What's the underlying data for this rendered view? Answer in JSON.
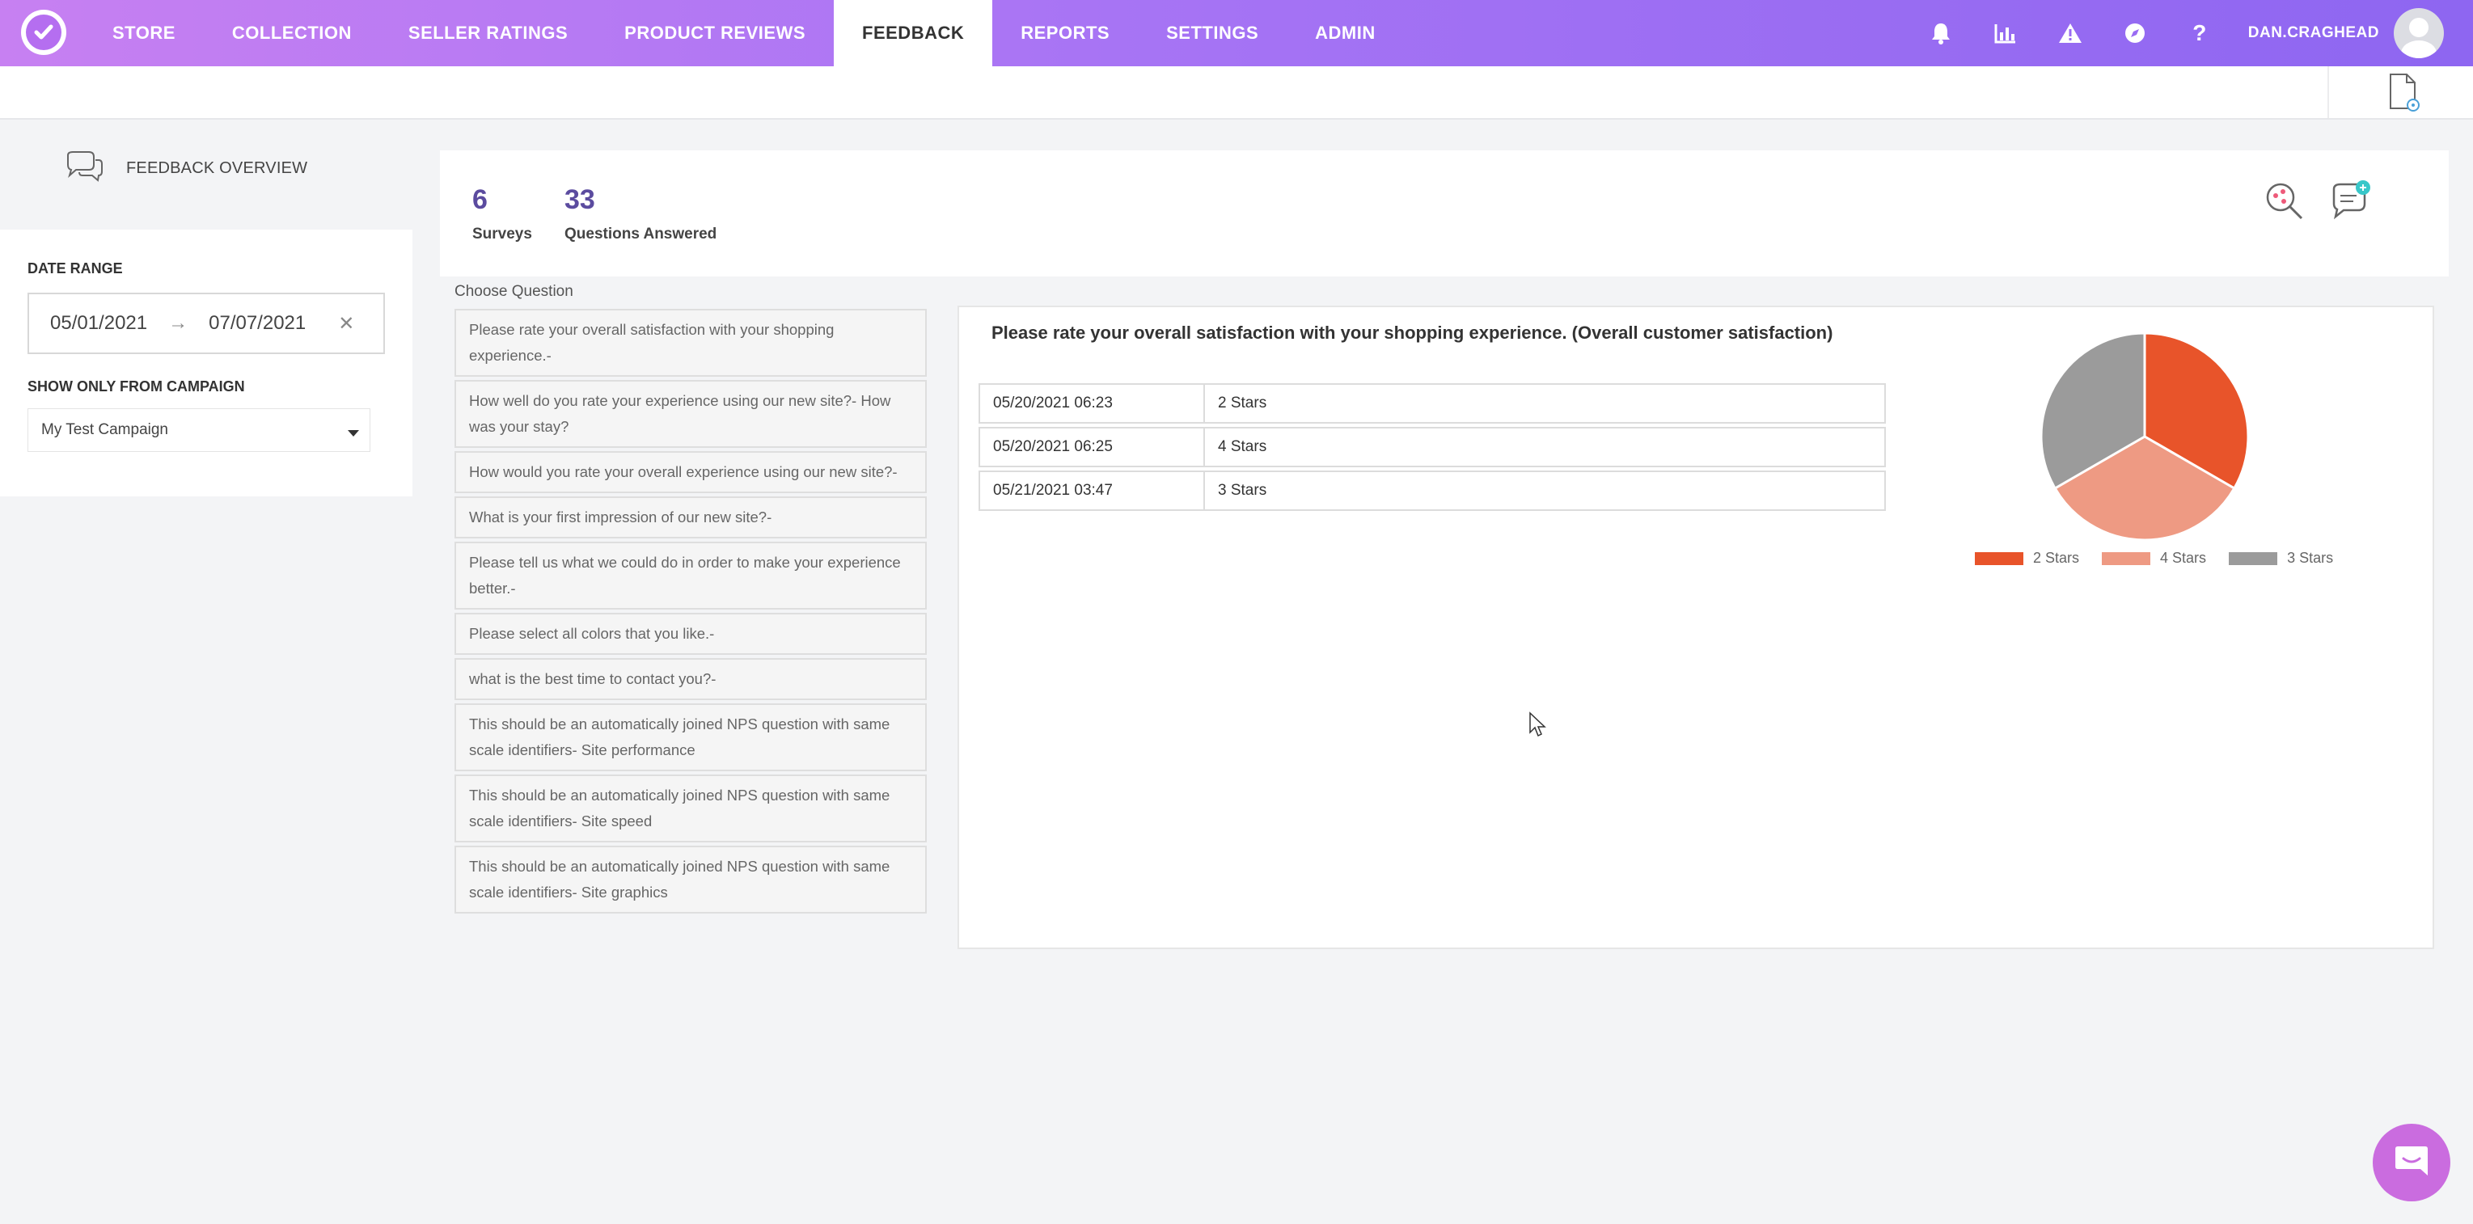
{
  "nav": {
    "tabs": [
      "STORE",
      "COLLECTION",
      "SELLER RATINGS",
      "PRODUCT REVIEWS",
      "FEEDBACK",
      "REPORTS",
      "SETTINGS",
      "ADMIN"
    ],
    "active_tab": "FEEDBACK",
    "username": "DAN.CRAGHEAD",
    "icons": [
      "bell-icon",
      "chart-icon",
      "warning-icon",
      "compass-icon",
      "help-icon"
    ],
    "help_glyph": "?"
  },
  "sidebar": {
    "overview_label": "FEEDBACK OVERVIEW",
    "date_range_label": "DATE RANGE",
    "date_from": "05/01/2021",
    "date_to": "07/07/2021",
    "arrow": "→",
    "clear_glyph": "✕",
    "campaign_label": "SHOW ONLY FROM CAMPAIGN",
    "campaign_value": "My Test Campaign"
  },
  "stats": {
    "surveys_count": "6",
    "surveys_label": "Surveys",
    "answered_count": "33",
    "answered_label": "Questions Answered"
  },
  "questions": {
    "label": "Choose Question",
    "items": [
      "Please rate your overall satisfaction with your shopping experience.-",
      "How well do you rate your experience using our new site?- How was your stay?",
      "How would you rate your overall experience using our new site?-",
      "What is your first impression of our new site?-",
      "Please tell us what we could do in order to make your experience better.-",
      "Please select all colors that you like.-",
      "what is the best time to contact you?-",
      "This should be an automatically joined NPS question with same scale identifiers- Site performance",
      "This should be an automatically joined NPS question with same scale identifiers- Site speed",
      "This should be an automatically joined NPS question with same scale identifiers- Site graphics"
    ]
  },
  "detail": {
    "title": "Please rate your overall satisfaction with your shopping experience. (Overall customer satisfaction)",
    "responses": [
      {
        "date": "05/20/2021 06:23",
        "value": "2 Stars"
      },
      {
        "date": "05/20/2021 06:25",
        "value": "4 Stars"
      },
      {
        "date": "05/21/2021 03:47",
        "value": "3 Stars"
      }
    ]
  },
  "chart_data": {
    "type": "pie",
    "categories": [
      "2 Stars",
      "4 Stars",
      "3 Stars"
    ],
    "values": [
      1,
      1,
      1
    ],
    "colors": [
      "#e8542a",
      "#ee9a83",
      "#9b9b9b"
    ],
    "legend_position": "bottom"
  },
  "colors": {
    "nav_gradient_start": "#c780f2",
    "nav_gradient_end": "#8e66f1",
    "stat_number": "#5b4b9f",
    "chat_button": "#ca6cdf"
  }
}
